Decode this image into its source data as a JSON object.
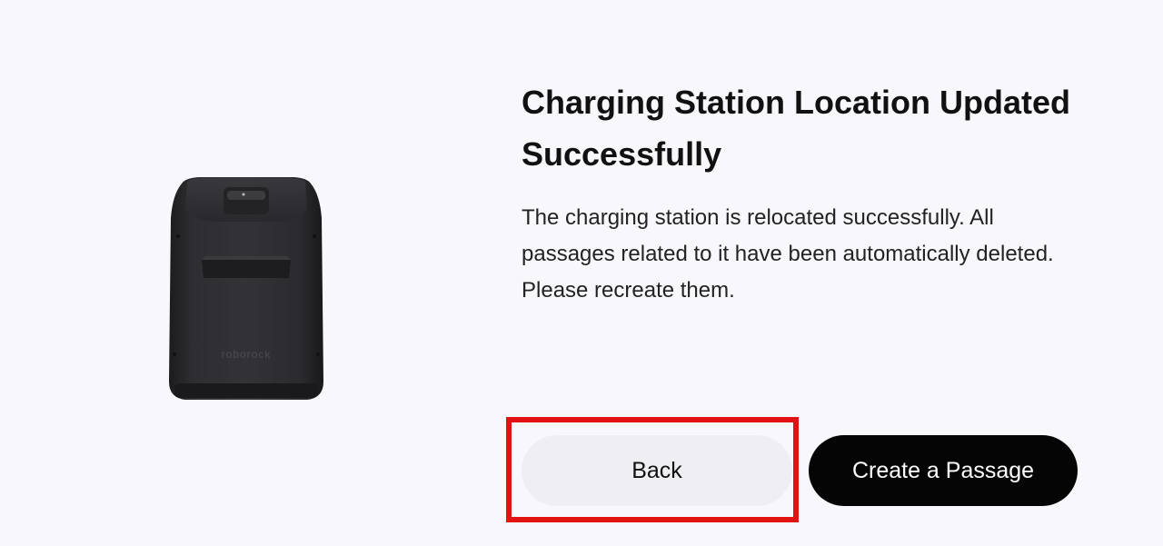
{
  "dialog": {
    "title": "Charging Station Location Updated Successfully",
    "description": "The charging station is relocated successfully. All passages related to it have been automatically deleted. Please recreate them.",
    "device_image": {
      "icon": "charging-station-image",
      "brand_text": "roborock"
    }
  },
  "buttons": {
    "back_label": "Back",
    "create_label": "Create a Passage"
  },
  "colors": {
    "background": "#f8f8fc",
    "back_button_bg": "#efeef3",
    "primary_button_bg": "#050505",
    "highlight_border": "#e31212"
  }
}
